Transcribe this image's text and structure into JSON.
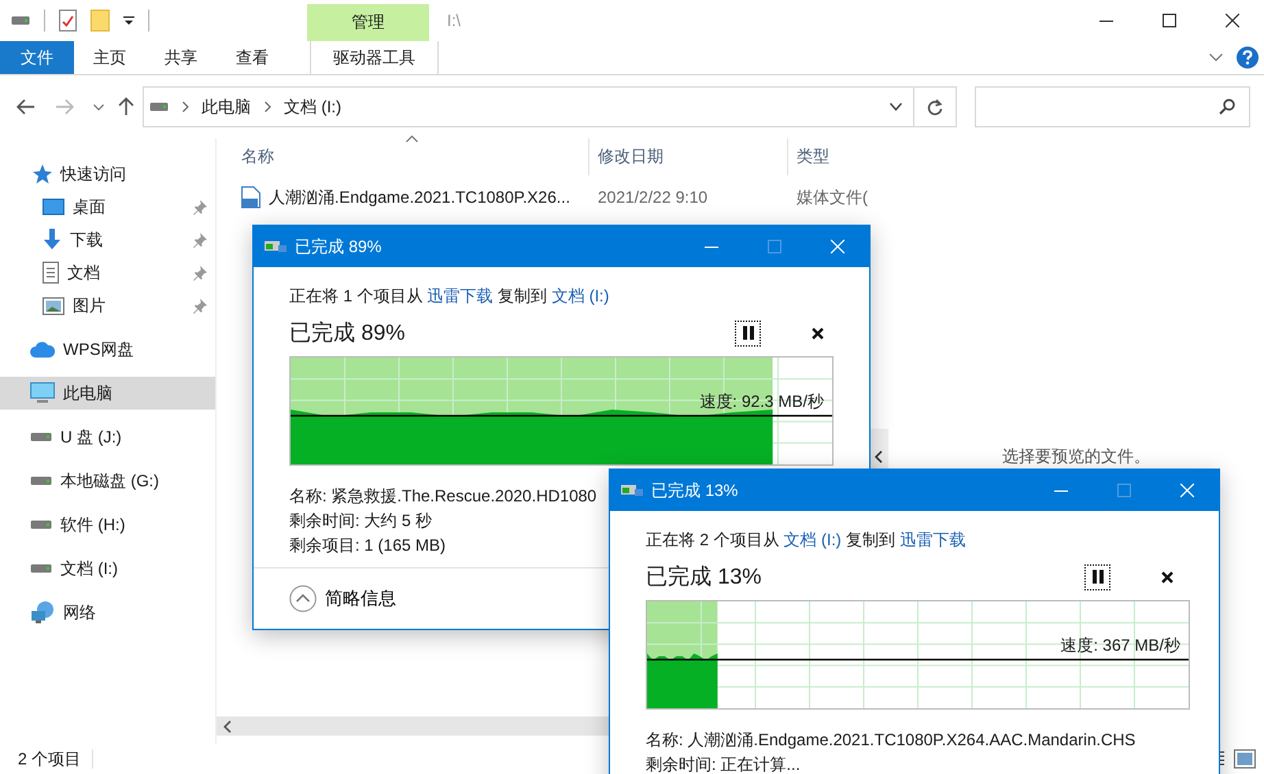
{
  "explorer": {
    "context_tab": "管理",
    "title": "I:\\",
    "ribbon_tabs": [
      {
        "label": "文件",
        "kind": "file",
        "selected": false
      },
      {
        "label": "主页",
        "kind": "tab",
        "selected": false
      },
      {
        "label": "共享",
        "kind": "tab",
        "selected": false
      },
      {
        "label": "查看",
        "kind": "tab",
        "selected": false
      },
      {
        "label": "驱动器工具",
        "kind": "tab",
        "selected": true
      }
    ],
    "crumbs": [
      "此电脑",
      "文档 (I:)"
    ],
    "sidebar": [
      {
        "label": "快速访问",
        "kind": "star",
        "selected": false,
        "children": [
          {
            "label": "桌面",
            "kind": "desktop",
            "pinned": true,
            "selected": false
          },
          {
            "label": "下载",
            "kind": "download",
            "pinned": true,
            "selected": false
          },
          {
            "label": "文档",
            "kind": "document",
            "pinned": true,
            "selected": false
          },
          {
            "label": "图片",
            "kind": "picture",
            "pinned": true,
            "selected": false
          }
        ]
      },
      {
        "label": "WPS网盘",
        "kind": "cloud",
        "selected": false
      },
      {
        "label": "此电脑",
        "kind": "pc",
        "selected": true
      },
      {
        "label": "U 盘 (J:)",
        "kind": "drive",
        "selected": false
      },
      {
        "label": "本地磁盘 (G:)",
        "kind": "drive",
        "selected": false
      },
      {
        "label": "软件 (H:)",
        "kind": "drive",
        "selected": false
      },
      {
        "label": "文档 (I:)",
        "kind": "drive",
        "selected": false
      },
      {
        "label": "网络",
        "kind": "network",
        "selected": false
      }
    ],
    "columns": [
      {
        "label": "名称",
        "sorted": true
      },
      {
        "label": "修改日期",
        "sorted": false
      },
      {
        "label": "类型",
        "sorted": false
      }
    ],
    "files": [
      {
        "name": "人潮汹涌.Endgame.2021.TC1080P.X26...",
        "date": "2021/2/22 9:10",
        "type": "媒体文件("
      }
    ],
    "preview_text": "选择要预览的文件。",
    "status": "2 个项目"
  },
  "dialogs": [
    {
      "title": "已完成 89%",
      "prefix": "正在将 1 个项目从",
      "source": "迅雷下载",
      "middle": "复制到",
      "dest": "文档 (I:)",
      "progress_text": "已完成 89%",
      "level": 0.89,
      "speed": "速度: 92.3 MB/秒",
      "details": [
        "名称: 紧急救援.The.Rescue.2020.HD1080",
        "剩余时间: 大约 5 秒",
        "剩余项目: 1 (165 MB)"
      ],
      "footer": "简略信息"
    },
    {
      "title": "已完成 13%",
      "prefix": "正在将 2 个项目从",
      "source": "文档 (I:)",
      "middle": "复制到",
      "dest": "迅雷下载",
      "progress_text": "已完成 13%",
      "level": 0.13,
      "speed": "速度: 367 MB/秒",
      "details": [
        "名称: 人潮汹涌.Endgame.2021.TC1080P.X264.AAC.Mandarin.CHS",
        "剩余时间: 正在计算..."
      ]
    }
  ]
}
